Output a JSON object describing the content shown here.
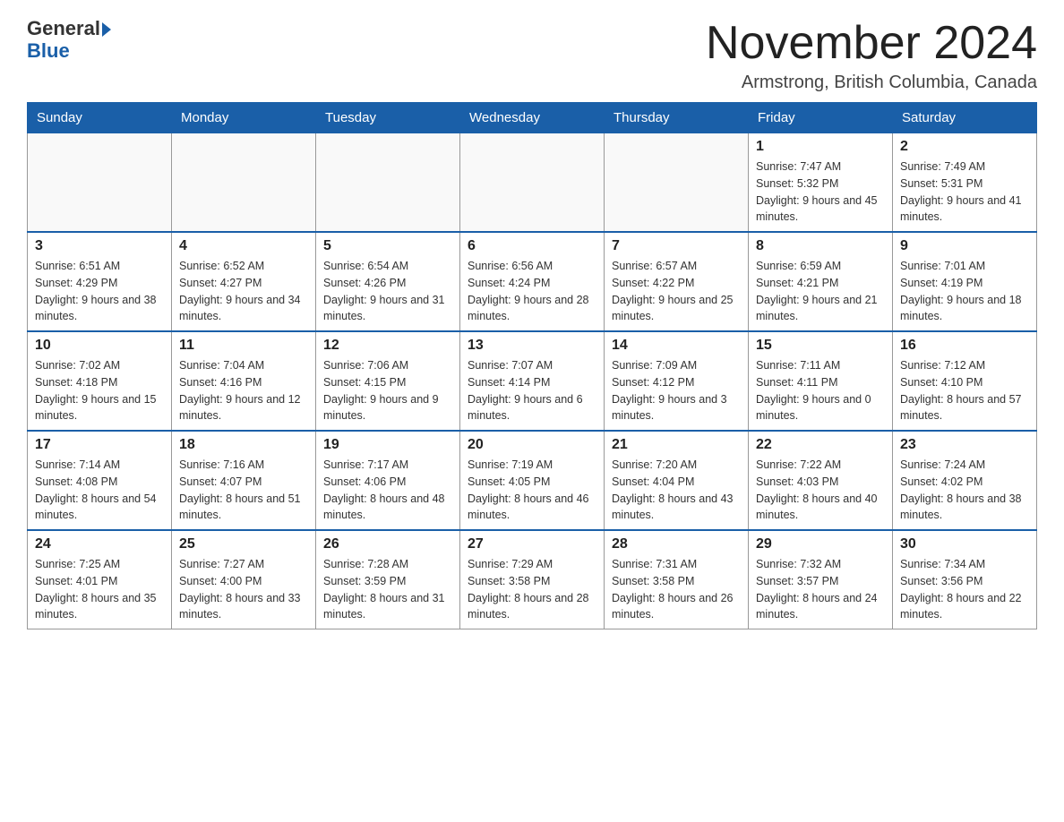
{
  "header": {
    "logo_general": "General",
    "logo_blue": "Blue",
    "title": "November 2024",
    "subtitle": "Armstrong, British Columbia, Canada"
  },
  "days_of_week": [
    "Sunday",
    "Monday",
    "Tuesday",
    "Wednesday",
    "Thursday",
    "Friday",
    "Saturday"
  ],
  "weeks": [
    [
      {
        "day": "",
        "sunrise": "",
        "sunset": "",
        "daylight": ""
      },
      {
        "day": "",
        "sunrise": "",
        "sunset": "",
        "daylight": ""
      },
      {
        "day": "",
        "sunrise": "",
        "sunset": "",
        "daylight": ""
      },
      {
        "day": "",
        "sunrise": "",
        "sunset": "",
        "daylight": ""
      },
      {
        "day": "",
        "sunrise": "",
        "sunset": "",
        "daylight": ""
      },
      {
        "day": "1",
        "sunrise": "Sunrise: 7:47 AM",
        "sunset": "Sunset: 5:32 PM",
        "daylight": "Daylight: 9 hours and 45 minutes."
      },
      {
        "day": "2",
        "sunrise": "Sunrise: 7:49 AM",
        "sunset": "Sunset: 5:31 PM",
        "daylight": "Daylight: 9 hours and 41 minutes."
      }
    ],
    [
      {
        "day": "3",
        "sunrise": "Sunrise: 6:51 AM",
        "sunset": "Sunset: 4:29 PM",
        "daylight": "Daylight: 9 hours and 38 minutes."
      },
      {
        "day": "4",
        "sunrise": "Sunrise: 6:52 AM",
        "sunset": "Sunset: 4:27 PM",
        "daylight": "Daylight: 9 hours and 34 minutes."
      },
      {
        "day": "5",
        "sunrise": "Sunrise: 6:54 AM",
        "sunset": "Sunset: 4:26 PM",
        "daylight": "Daylight: 9 hours and 31 minutes."
      },
      {
        "day": "6",
        "sunrise": "Sunrise: 6:56 AM",
        "sunset": "Sunset: 4:24 PM",
        "daylight": "Daylight: 9 hours and 28 minutes."
      },
      {
        "day": "7",
        "sunrise": "Sunrise: 6:57 AM",
        "sunset": "Sunset: 4:22 PM",
        "daylight": "Daylight: 9 hours and 25 minutes."
      },
      {
        "day": "8",
        "sunrise": "Sunrise: 6:59 AM",
        "sunset": "Sunset: 4:21 PM",
        "daylight": "Daylight: 9 hours and 21 minutes."
      },
      {
        "day": "9",
        "sunrise": "Sunrise: 7:01 AM",
        "sunset": "Sunset: 4:19 PM",
        "daylight": "Daylight: 9 hours and 18 minutes."
      }
    ],
    [
      {
        "day": "10",
        "sunrise": "Sunrise: 7:02 AM",
        "sunset": "Sunset: 4:18 PM",
        "daylight": "Daylight: 9 hours and 15 minutes."
      },
      {
        "day": "11",
        "sunrise": "Sunrise: 7:04 AM",
        "sunset": "Sunset: 4:16 PM",
        "daylight": "Daylight: 9 hours and 12 minutes."
      },
      {
        "day": "12",
        "sunrise": "Sunrise: 7:06 AM",
        "sunset": "Sunset: 4:15 PM",
        "daylight": "Daylight: 9 hours and 9 minutes."
      },
      {
        "day": "13",
        "sunrise": "Sunrise: 7:07 AM",
        "sunset": "Sunset: 4:14 PM",
        "daylight": "Daylight: 9 hours and 6 minutes."
      },
      {
        "day": "14",
        "sunrise": "Sunrise: 7:09 AM",
        "sunset": "Sunset: 4:12 PM",
        "daylight": "Daylight: 9 hours and 3 minutes."
      },
      {
        "day": "15",
        "sunrise": "Sunrise: 7:11 AM",
        "sunset": "Sunset: 4:11 PM",
        "daylight": "Daylight: 9 hours and 0 minutes."
      },
      {
        "day": "16",
        "sunrise": "Sunrise: 7:12 AM",
        "sunset": "Sunset: 4:10 PM",
        "daylight": "Daylight: 8 hours and 57 minutes."
      }
    ],
    [
      {
        "day": "17",
        "sunrise": "Sunrise: 7:14 AM",
        "sunset": "Sunset: 4:08 PM",
        "daylight": "Daylight: 8 hours and 54 minutes."
      },
      {
        "day": "18",
        "sunrise": "Sunrise: 7:16 AM",
        "sunset": "Sunset: 4:07 PM",
        "daylight": "Daylight: 8 hours and 51 minutes."
      },
      {
        "day": "19",
        "sunrise": "Sunrise: 7:17 AM",
        "sunset": "Sunset: 4:06 PM",
        "daylight": "Daylight: 8 hours and 48 minutes."
      },
      {
        "day": "20",
        "sunrise": "Sunrise: 7:19 AM",
        "sunset": "Sunset: 4:05 PM",
        "daylight": "Daylight: 8 hours and 46 minutes."
      },
      {
        "day": "21",
        "sunrise": "Sunrise: 7:20 AM",
        "sunset": "Sunset: 4:04 PM",
        "daylight": "Daylight: 8 hours and 43 minutes."
      },
      {
        "day": "22",
        "sunrise": "Sunrise: 7:22 AM",
        "sunset": "Sunset: 4:03 PM",
        "daylight": "Daylight: 8 hours and 40 minutes."
      },
      {
        "day": "23",
        "sunrise": "Sunrise: 7:24 AM",
        "sunset": "Sunset: 4:02 PM",
        "daylight": "Daylight: 8 hours and 38 minutes."
      }
    ],
    [
      {
        "day": "24",
        "sunrise": "Sunrise: 7:25 AM",
        "sunset": "Sunset: 4:01 PM",
        "daylight": "Daylight: 8 hours and 35 minutes."
      },
      {
        "day": "25",
        "sunrise": "Sunrise: 7:27 AM",
        "sunset": "Sunset: 4:00 PM",
        "daylight": "Daylight: 8 hours and 33 minutes."
      },
      {
        "day": "26",
        "sunrise": "Sunrise: 7:28 AM",
        "sunset": "Sunset: 3:59 PM",
        "daylight": "Daylight: 8 hours and 31 minutes."
      },
      {
        "day": "27",
        "sunrise": "Sunrise: 7:29 AM",
        "sunset": "Sunset: 3:58 PM",
        "daylight": "Daylight: 8 hours and 28 minutes."
      },
      {
        "day": "28",
        "sunrise": "Sunrise: 7:31 AM",
        "sunset": "Sunset: 3:58 PM",
        "daylight": "Daylight: 8 hours and 26 minutes."
      },
      {
        "day": "29",
        "sunrise": "Sunrise: 7:32 AM",
        "sunset": "Sunset: 3:57 PM",
        "daylight": "Daylight: 8 hours and 24 minutes."
      },
      {
        "day": "30",
        "sunrise": "Sunrise: 7:34 AM",
        "sunset": "Sunset: 3:56 PM",
        "daylight": "Daylight: 8 hours and 22 minutes."
      }
    ]
  ]
}
